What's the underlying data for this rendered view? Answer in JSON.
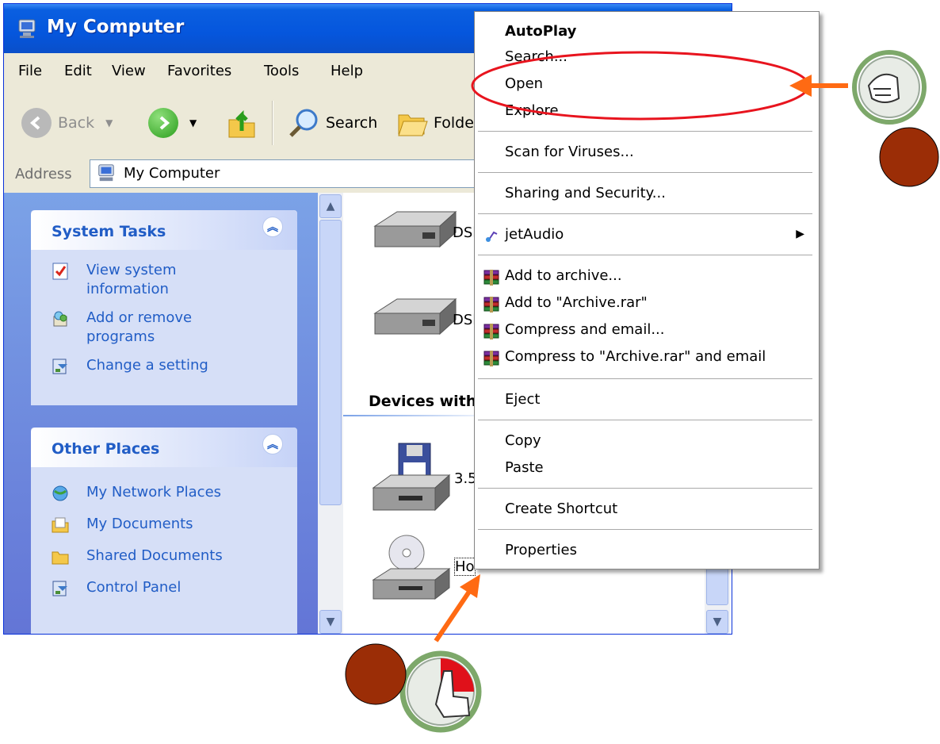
{
  "window": {
    "title": "My Computer"
  },
  "menubar": [
    "File",
    "Edit",
    "View",
    "Favorites",
    "Tools",
    "Help"
  ],
  "toolbar": {
    "back": "Back",
    "search": "Search",
    "folders": "Folde"
  },
  "address": {
    "label": "Address",
    "value": "My Computer"
  },
  "left_pane": {
    "system_tasks": {
      "title": "System Tasks",
      "items": [
        {
          "line1": "View system",
          "line2": "information",
          "icon": "system-info-icon"
        },
        {
          "line1": "Add or remove",
          "line2": "programs",
          "icon": "add-remove-icon"
        },
        {
          "line1": "Change a setting",
          "line2": "",
          "icon": "control-panel-icon"
        }
      ]
    },
    "other_places": {
      "title": "Other Places",
      "items": [
        {
          "label": "My Network Places",
          "icon": "network-icon"
        },
        {
          "label": "My Documents",
          "icon": "documents-icon"
        },
        {
          "label": "Shared Documents",
          "icon": "folder-icon"
        },
        {
          "label": "Control Panel",
          "icon": "control-panel-icon"
        }
      ]
    }
  },
  "content": {
    "drives": [
      {
        "label": "DSl",
        "icon": "hard-drive-icon"
      },
      {
        "label": "DSl",
        "icon": "hard-drive-icon"
      },
      {
        "label": "3.5",
        "icon": "floppy-drive-icon"
      },
      {
        "label": "Ho",
        "icon": "cd-drive-icon"
      }
    ],
    "group_heading": "Devices with"
  },
  "context_menu": {
    "autoplay": "AutoPlay",
    "search": "Search...",
    "open": "Open",
    "explore": "Explore",
    "scan": "Scan for Viruses...",
    "sharing": "Sharing and Security...",
    "jetaudio": "jetAudio",
    "add_archive": "Add to archive...",
    "add_rar": "Add to \"Archive.rar\"",
    "compress_email": "Compress and email...",
    "compress_rar_email": "Compress to \"Archive.rar\" and email",
    "eject": "Eject",
    "copy": "Copy",
    "paste": "Paste",
    "create_shortcut": "Create Shortcut",
    "properties": "Properties"
  },
  "colors": {
    "titlebar": "#0556dd",
    "annotation_arrow": "#ff6a13",
    "annotation_circle": "#9b2d06",
    "highlight_ellipse": "#e8141e",
    "task_link": "#215dc6"
  }
}
